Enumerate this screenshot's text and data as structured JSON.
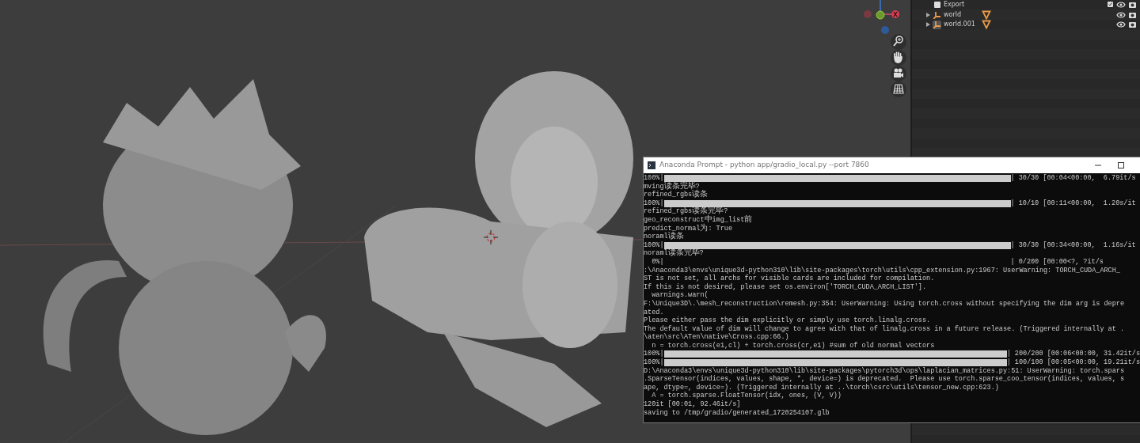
{
  "outliner": {
    "rows": [
      {
        "label": "Export",
        "kind": "collection",
        "expandable": false,
        "selected": false
      },
      {
        "label": "world",
        "kind": "object",
        "expandable": true,
        "selected": false
      },
      {
        "label": "world.001",
        "kind": "object",
        "expandable": true,
        "selected": true
      }
    ]
  },
  "terminal": {
    "title": "Anaconda Prompt - python  app/gradio_local.py --port 7860",
    "lines": [
      {
        "kind": "progress",
        "prefix": "100%|",
        "level": 1,
        "suffix": "| 30/30 [00:04<00:00,  6.79it/s"
      },
      {
        "kind": "text",
        "text": "mving读条完毕?"
      },
      {
        "kind": "text",
        "text": "refined_rgbs读条"
      },
      {
        "kind": "progress",
        "prefix": "100%|",
        "level": 1,
        "suffix": "| 10/10 [00:11<00:00,  1.20s/it"
      },
      {
        "kind": "text",
        "text": "refined_rgbs读条完毕?"
      },
      {
        "kind": "text",
        "text": "geo_reconstruct中img_list前"
      },
      {
        "kind": "text",
        "text": "predict_normal为: True"
      },
      {
        "kind": "text",
        "text": "noraml读条"
      },
      {
        "kind": "progress",
        "prefix": "100%|",
        "level": 1,
        "suffix": "| 30/30 [00:34<00:00,  1.16s/it"
      },
      {
        "kind": "text",
        "text": "noraml读条完毕?"
      },
      {
        "kind": "progress",
        "prefix": "  0%|",
        "level": 0,
        "suffix": "| 0/200 [00:00<?, ?it/s"
      },
      {
        "kind": "text",
        "text": ":\\Anaconda3\\envs\\unique3d-python310\\lib\\site-packages\\torch\\utils\\cpp_extension.py:1967: UserWarning: TORCH_CUDA_ARCH_"
      },
      {
        "kind": "text",
        "text": "ST is not set, all archs for visible cards are included for compilation."
      },
      {
        "kind": "text",
        "text": "If this is not desired, please set os.environ['TORCH_CUDA_ARCH_LIST']."
      },
      {
        "kind": "text",
        "text": "  warnings.warn("
      },
      {
        "kind": "text",
        "text": "F:\\Unique3D\\.\\mesh_reconstruction\\remesh.py:354: UserWarning: Using torch.cross without specifying the dim arg is depre"
      },
      {
        "kind": "text",
        "text": "ated."
      },
      {
        "kind": "text",
        "text": "Please either pass the dim explicitly or simply use torch.linalg.cross."
      },
      {
        "kind": "text",
        "text": "The default value of dim will change to agree with that of linalg.cross in a future release. (Triggered internally at ."
      },
      {
        "kind": "text",
        "text": "\\aten\\src\\ATen\\native\\Cross.cpp:66.)"
      },
      {
        "kind": "text",
        "text": "  n = torch.cross(e1,cl) + torch.cross(cr,e1) #sum of old normal vectors"
      },
      {
        "kind": "progress",
        "prefix": "100%|",
        "level": 1,
        "suffix": "| 200/200 [00:06<00:00, 31.42it/s"
      },
      {
        "kind": "progress",
        "prefix": "100%|",
        "level": 1,
        "suffix": "| 100/100 [00:05<00:00, 19.21it/s"
      },
      {
        "kind": "text",
        "text": "D:\\Anaconda3\\envs\\unique3d-python310\\lib\\site-packages\\pytorch3d\\ops\\laplacian_matrices.py:51: UserWarning: torch.spars"
      },
      {
        "kind": "text",
        "text": ".SparseTensor(indices, values, shape, *, device=) is deprecated.  Please use torch.sparse_coo_tensor(indices, values, s"
      },
      {
        "kind": "text",
        "text": "ape, dtype=, device=). (Triggered internally at ..\\torch\\csrc\\utils\\tensor_new.cpp:623.)"
      },
      {
        "kind": "text",
        "text": "  A = torch.sparse.FloatTensor(idx, ones, (V, V))"
      },
      {
        "kind": "text",
        "text": "120it [00:01, 92.46it/s]"
      },
      {
        "kind": "text",
        "text": "saving to /tmp/gradio/generated_1720254107.glb"
      }
    ]
  }
}
